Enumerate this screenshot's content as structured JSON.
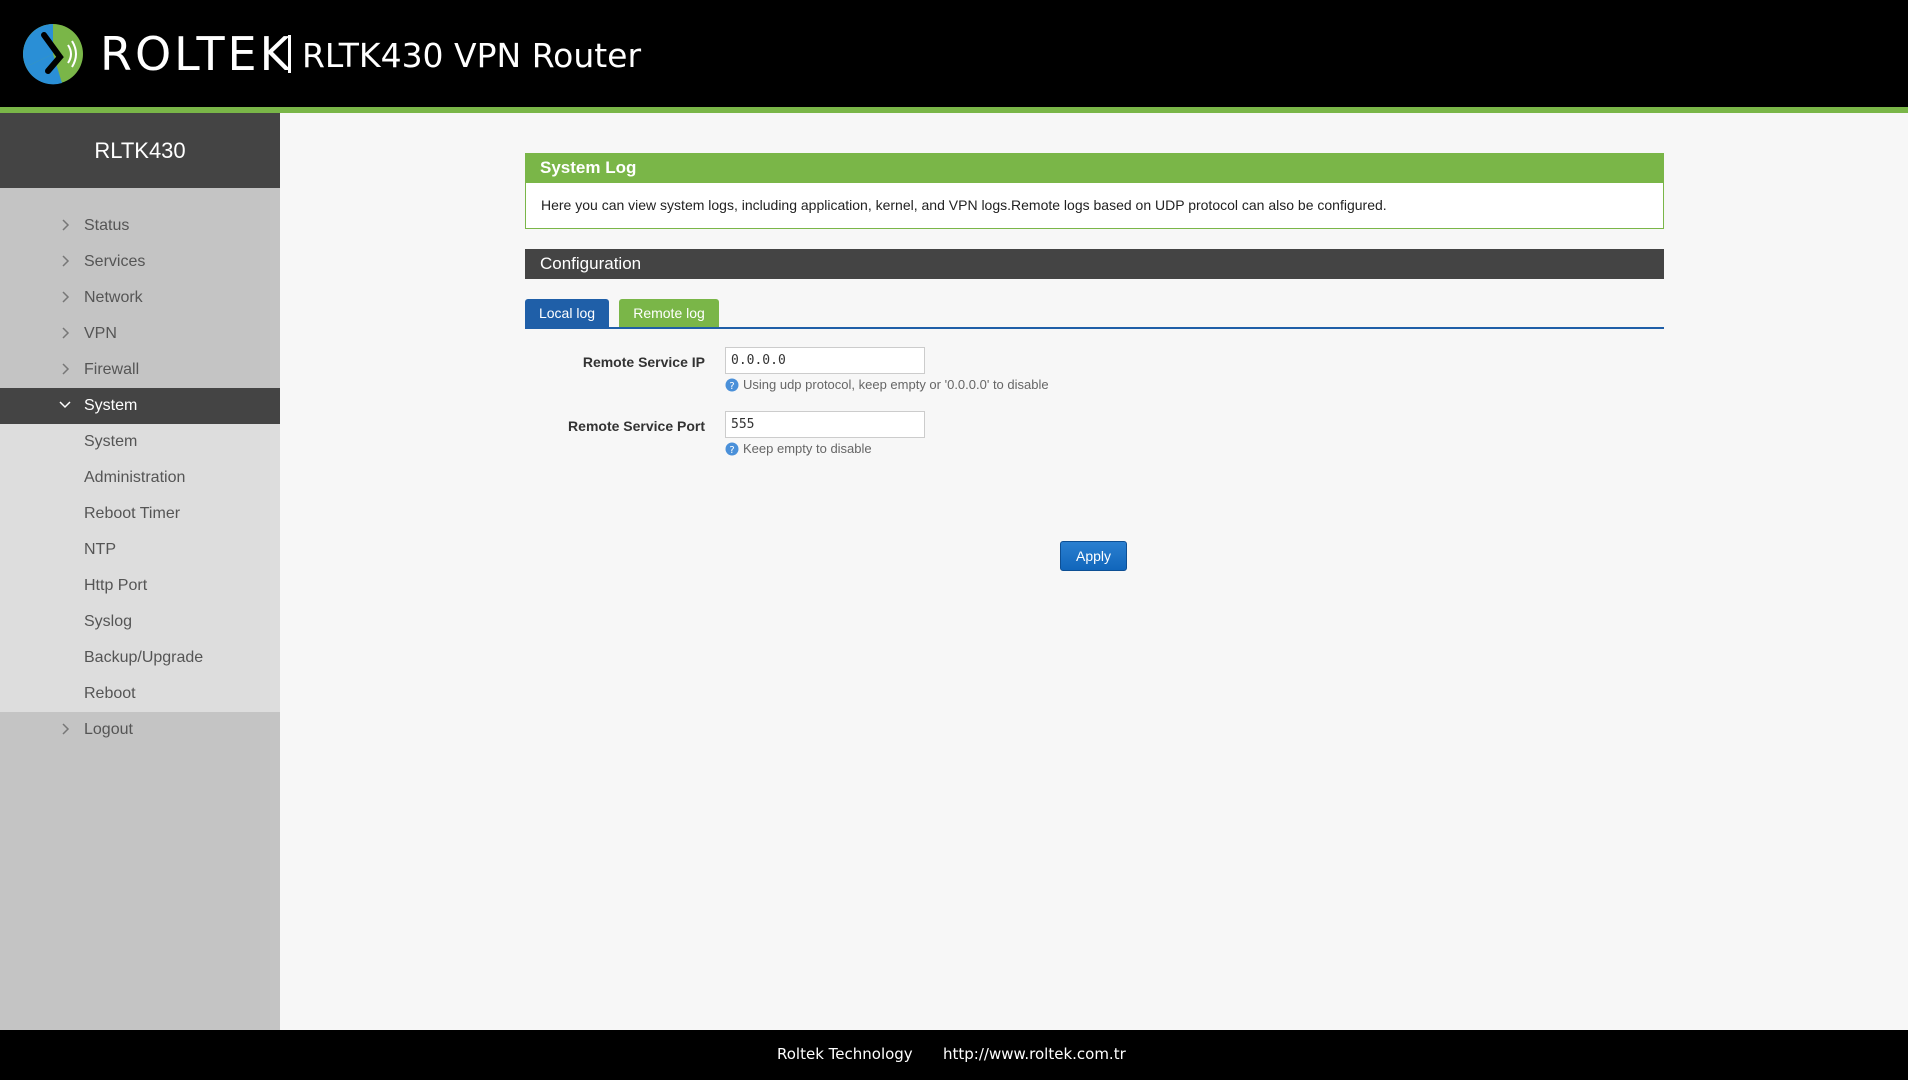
{
  "header": {
    "brand": "ROLTEK",
    "product_title": "RLTK430 VPN Router"
  },
  "sidebar": {
    "title": "RLTK430",
    "items": [
      {
        "label": "Status"
      },
      {
        "label": "Services"
      },
      {
        "label": "Network"
      },
      {
        "label": "VPN"
      },
      {
        "label": "Firewall"
      },
      {
        "label": "System"
      },
      {
        "label": "Logout"
      }
    ],
    "system_sub": [
      {
        "label": "System"
      },
      {
        "label": "Administration"
      },
      {
        "label": "Reboot Timer"
      },
      {
        "label": "NTP"
      },
      {
        "label": "Http Port"
      },
      {
        "label": "Syslog"
      },
      {
        "label": "Backup/Upgrade"
      },
      {
        "label": "Reboot"
      }
    ]
  },
  "main": {
    "panel_title": "System Log",
    "panel_description": "Here you can view system logs, including application, kernel, and VPN logs.Remote logs based on UDP protocol can also be configured.",
    "config_title": "Configuration",
    "tabs": [
      {
        "label": "Local log"
      },
      {
        "label": "Remote log"
      }
    ],
    "form": {
      "remote_ip_label": "Remote Service IP",
      "remote_ip_value": "0.0.0.0",
      "remote_ip_hint": "Using udp protocol, keep empty or '0.0.0.0' to disable",
      "remote_port_label": "Remote Service Port",
      "remote_port_value": "555",
      "remote_port_hint": "Keep empty to disable"
    },
    "apply_label": "Apply"
  },
  "footer": {
    "company": "Roltek Technology",
    "url": "http://www.roltek.com.tr"
  },
  "colors": {
    "accent_green": "#7ab648",
    "tab_blue": "#1f5fa8",
    "dark": "#444444"
  }
}
